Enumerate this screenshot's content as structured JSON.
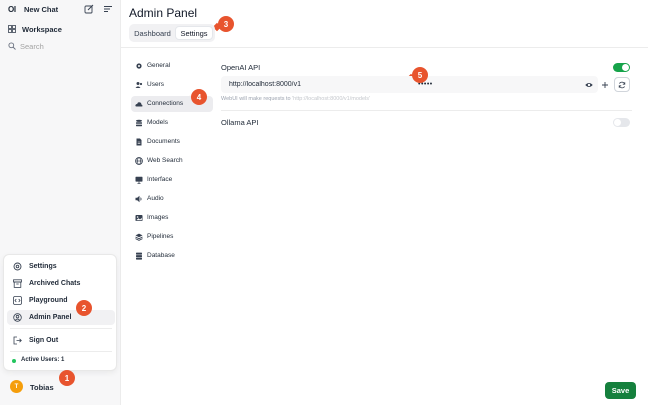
{
  "sidebar": {
    "logo_text": "OI",
    "new_chat_label": "New Chat",
    "workspace_label": "Workspace",
    "search_placeholder": "Search"
  },
  "user_menu": {
    "items": [
      {
        "label": "Settings",
        "icon": "settings-icon"
      },
      {
        "label": "Archived Chats",
        "icon": "archive-icon"
      },
      {
        "label": "Playground",
        "icon": "code-icon"
      },
      {
        "label": "Admin Panel",
        "icon": "user-circle-icon"
      },
      {
        "label": "Sign Out",
        "icon": "sign-out-icon"
      }
    ],
    "active_users_label": "Active Users:",
    "active_users_count": "1"
  },
  "user": {
    "avatar_initial": "T",
    "name": "Tobias"
  },
  "main": {
    "title": "Admin Panel",
    "tabs": [
      {
        "label": "Dashboard"
      },
      {
        "label": "Settings"
      }
    ]
  },
  "settings_nav": [
    {
      "label": "General",
      "icon": "gear-icon"
    },
    {
      "label": "Users",
      "icon": "users-icon"
    },
    {
      "label": "Connections",
      "icon": "cloud-icon"
    },
    {
      "label": "Models",
      "icon": "stack-icon"
    },
    {
      "label": "Documents",
      "icon": "document-icon"
    },
    {
      "label": "Web Search",
      "icon": "globe-icon"
    },
    {
      "label": "Interface",
      "icon": "monitor-icon"
    },
    {
      "label": "Audio",
      "icon": "speaker-icon"
    },
    {
      "label": "Images",
      "icon": "image-icon"
    },
    {
      "label": "Pipelines",
      "icon": "layers-icon"
    },
    {
      "label": "Database",
      "icon": "database-icon"
    }
  ],
  "connections": {
    "openai_label": "OpenAI API",
    "openai_enabled": true,
    "api_base_url": "http://localhost:8000/v1",
    "api_key_masked": "•••••",
    "helper_prefix": "WebUI will make requests to",
    "helper_url": "'http://localhost:8000/v1/models'",
    "ollama_label": "Ollama API",
    "ollama_enabled": false,
    "save_label": "Save"
  },
  "annotations": [
    "1",
    "2",
    "3",
    "4",
    "5"
  ],
  "colors": {
    "accent_green": "#16a34a",
    "save_green": "#15803d",
    "badge": "#e8542e",
    "avatar": "#f59e0b"
  }
}
